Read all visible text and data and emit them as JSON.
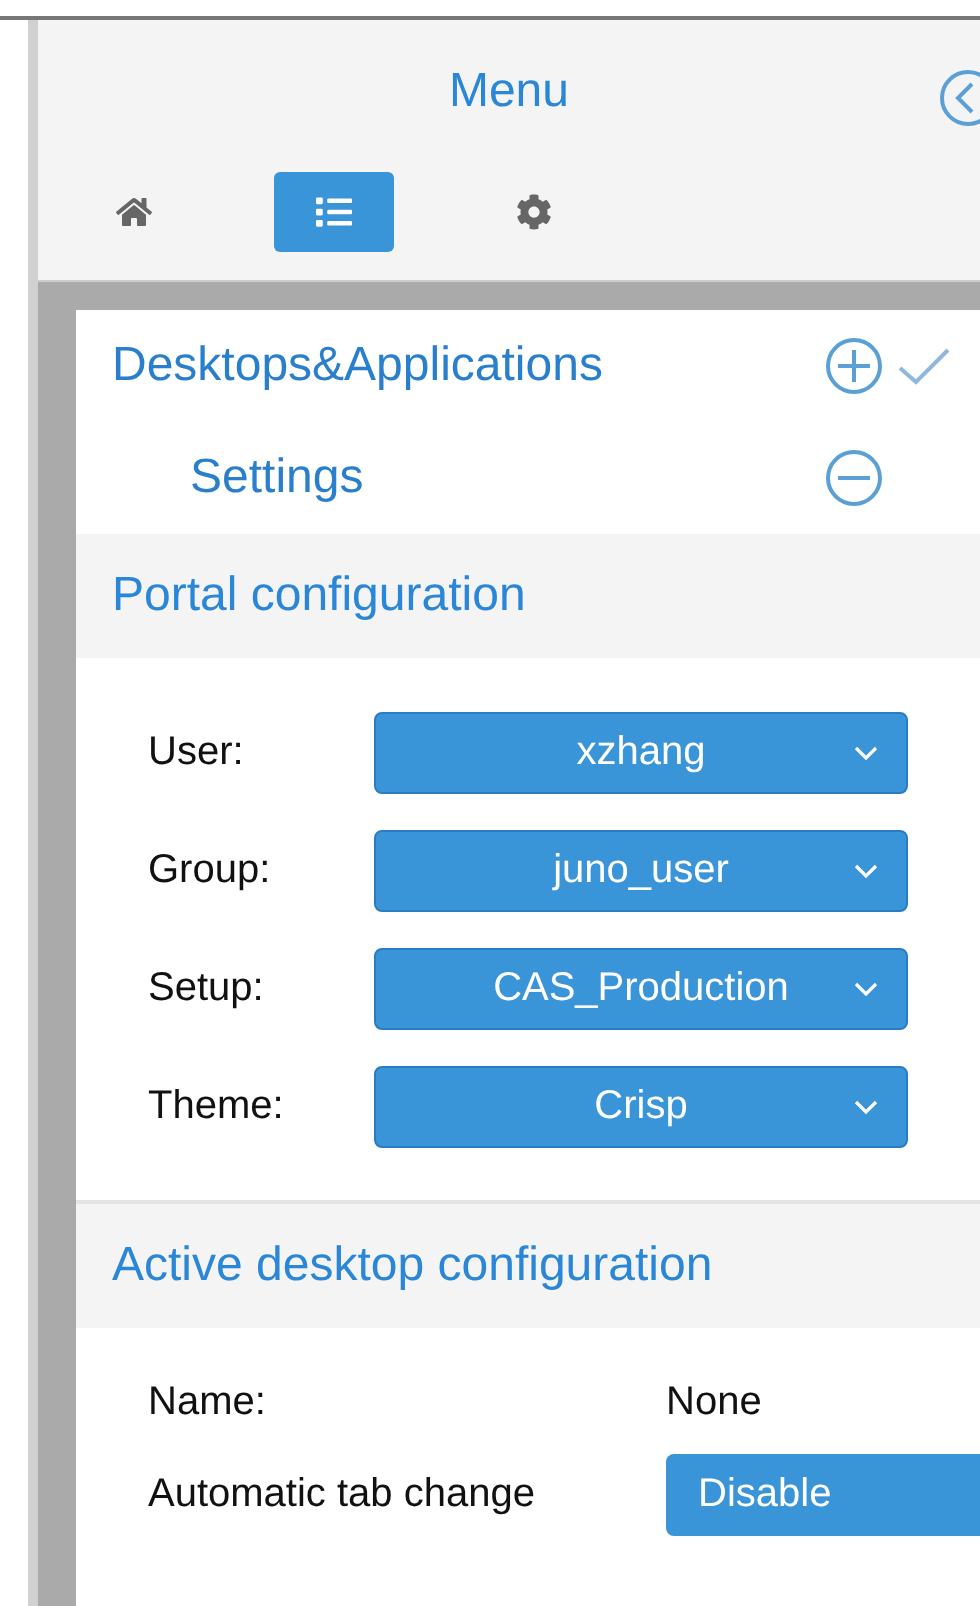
{
  "menu": {
    "title": "Menu"
  },
  "tabs": [
    {
      "kind": "home",
      "selected": false
    },
    {
      "kind": "list",
      "selected": true
    },
    {
      "kind": "settings",
      "selected": false
    }
  ],
  "tree": [
    {
      "label": "Desktops&Applications",
      "expanded": false,
      "checked": true,
      "children": [
        {
          "label": "Settings",
          "expanded": true
        }
      ]
    }
  ],
  "portal_configuration": {
    "title": "Portal configuration",
    "fields": [
      {
        "label": "User:",
        "value": "xzhang"
      },
      {
        "label": "Group:",
        "value": "juno_user"
      },
      {
        "label": "Setup:",
        "value": "CAS_Production"
      },
      {
        "label": "Theme:",
        "value": "Crisp"
      }
    ]
  },
  "active_desktop_configuration": {
    "title": "Active desktop configuration",
    "name_label": "Name:",
    "name_value": "None",
    "tab_change_label": "Automatic tab change",
    "tab_change_button": "Disable"
  }
}
